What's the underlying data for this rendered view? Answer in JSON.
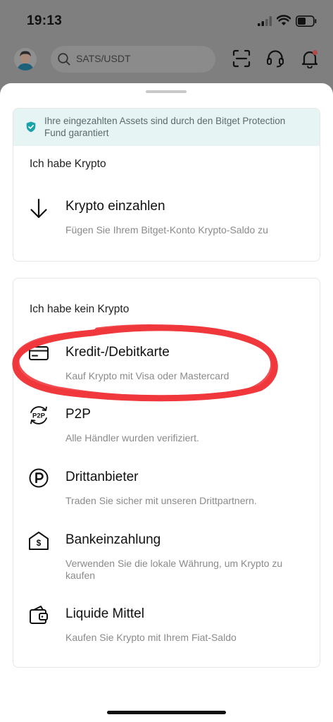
{
  "status_bar": {
    "time": "19:13"
  },
  "header": {
    "search": {
      "text": "SATS/USDT"
    },
    "icons": [
      "avatar",
      "scan-icon",
      "headset-icon",
      "bell-icon"
    ]
  },
  "sheet": {
    "notice": {
      "text": "Ihre eingezahlten Assets sind durch den Bitget Protection Fund garantiert"
    },
    "sections": [
      {
        "title": "Ich habe Krypto",
        "items": [
          {
            "icon": "arrow-down-icon",
            "title": "Krypto einzahlen",
            "desc": "Fügen Sie Ihrem Bitget-Konto Krypto-Saldo zu"
          }
        ]
      },
      {
        "title": "Ich habe kein Krypto",
        "items": [
          {
            "icon": "credit-card-icon",
            "title": "Kredit-/Debitkarte",
            "desc": "Kauf Krypto mit Visa oder Mastercard"
          },
          {
            "icon": "p2p-icon",
            "title": "P2P",
            "desc": "Alle Händler wurden verifiziert."
          },
          {
            "icon": "third-party-icon",
            "title": "Drittanbieter",
            "desc": "Traden Sie sicher mit unseren Drittpartnern."
          },
          {
            "icon": "bank-icon",
            "title": "Bankeinzahlung",
            "desc": "Verwenden Sie die lokale Währung, um Krypto zu kaufen"
          },
          {
            "icon": "wallet-icon",
            "title": "Liquide Mittel",
            "desc": "Kaufen Sie Krypto mit Ihrem Fiat-Saldo"
          }
        ]
      }
    ]
  },
  "colors": {
    "overlay": "#7f7f7f",
    "notice_bg": "#e6f4f4",
    "shield": "#1aa3a8",
    "annotation": "#f0393c"
  }
}
